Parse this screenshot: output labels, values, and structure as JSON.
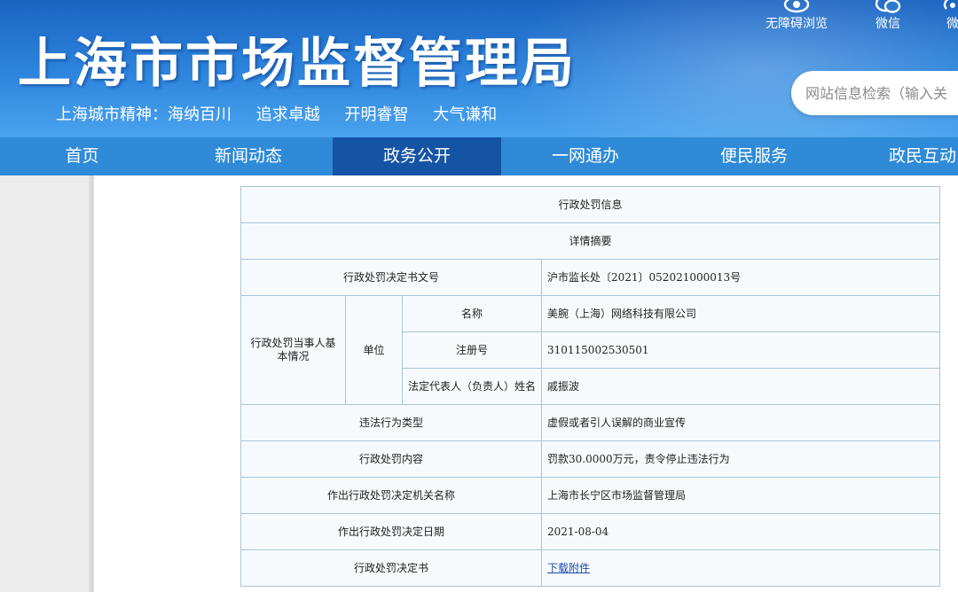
{
  "header": {
    "site_title": "上海市市场监督管理局",
    "motto": [
      "上海城市精神：海纳百川",
      "追求卓越",
      "开明睿智",
      "大气谦和"
    ],
    "tools": [
      {
        "label": "无障碍浏览",
        "icon": "eye-icon"
      },
      {
        "label": "微信",
        "icon": "wechat-icon"
      },
      {
        "label": "微",
        "icon": "weibo-icon"
      }
    ],
    "search": {
      "placeholder": "网站信息检索（输入关"
    }
  },
  "nav": {
    "items": [
      "首页",
      "新闻动态",
      "政务公开",
      "一网通办",
      "便民服务",
      "政民互动"
    ],
    "active_index": 2
  },
  "table": {
    "title": "行政处罚信息",
    "subtitle": "详情摘要",
    "decision_no_label": "行政处罚决定书文号",
    "decision_no": "沪市监长处〔2021〕052021000013号",
    "party_label": "行政处罚当事人基本情况",
    "unit_label": "单位",
    "name_label": "名称",
    "name_value": "美腕（上海）网络科技有限公司",
    "reg_label": "注册号",
    "reg_value": "310115002530501",
    "rep_label": "法定代表人（负责人）姓名",
    "rep_value": "戚振波",
    "violation_type_label": "违法行为类型",
    "violation_type": "虚假或者引人误解的商业宣传",
    "penalty_content_label": "行政处罚内容",
    "penalty_content": "罚款30.0000万元，责令停止违法行为",
    "authority_label": "作出行政处罚决定机关名称",
    "authority": "上海市长宁区市场监督管理局",
    "date_label": "作出行政处罚决定日期",
    "date": "2021-08-04",
    "document_label": "行政处罚决定书",
    "document_link": "下载附件"
  },
  "colors": {
    "header_top": "#1b64c2",
    "nav_bg": "#2f8ad7",
    "nav_active": "#1553a5",
    "table_border": "#a9c4dc",
    "link": "#1a4ca8"
  }
}
